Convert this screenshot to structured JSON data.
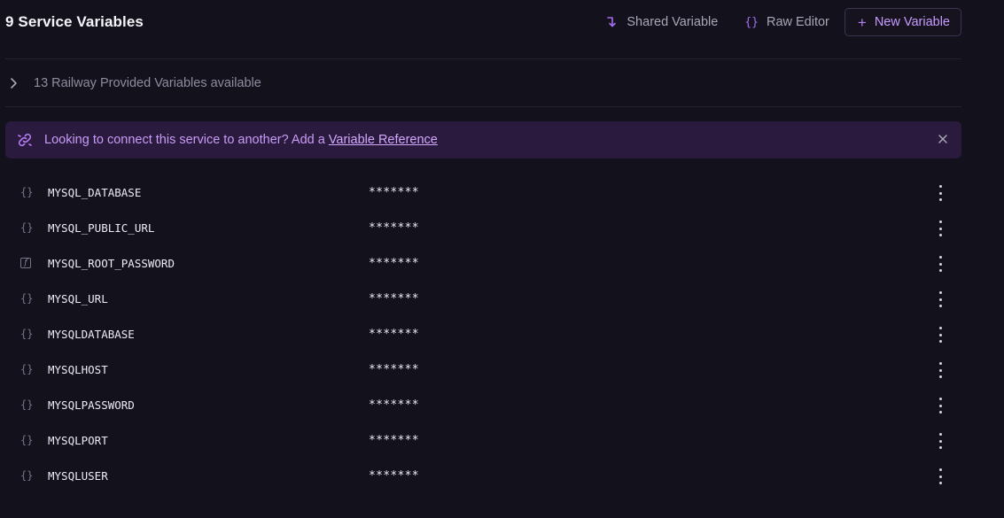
{
  "header": {
    "title": "9 Service Variables",
    "shared_label": "Shared Variable",
    "raw_label": "Raw Editor",
    "raw_icon_text": "{}",
    "new_label": "New Variable",
    "new_icon_text": "+"
  },
  "provided": {
    "label": "13 Railway Provided Variables available"
  },
  "banner": {
    "text": "Looking to connect this service to another? Add a",
    "link_label": "Variable Reference"
  },
  "variables": [
    {
      "icon": "braces-icon",
      "type_glyph": "{}",
      "name": "MYSQL_DATABASE",
      "value": "*******"
    },
    {
      "icon": "braces-icon",
      "type_glyph": "{}",
      "name": "MYSQL_PUBLIC_URL",
      "value": "*******"
    },
    {
      "icon": "function-icon",
      "type_glyph": "f",
      "name": "MYSQL_ROOT_PASSWORD",
      "value": "*******"
    },
    {
      "icon": "braces-icon",
      "type_glyph": "{}",
      "name": "MYSQL_URL",
      "value": "*******"
    },
    {
      "icon": "braces-icon",
      "type_glyph": "{}",
      "name": "MYSQLDATABASE",
      "value": "*******"
    },
    {
      "icon": "braces-icon",
      "type_glyph": "{}",
      "name": "MYSQLHOST",
      "value": "*******"
    },
    {
      "icon": "braces-icon",
      "type_glyph": "{}",
      "name": "MYSQLPASSWORD",
      "value": "*******"
    },
    {
      "icon": "braces-icon",
      "type_glyph": "{}",
      "name": "MYSQLPORT",
      "value": "*******"
    },
    {
      "icon": "braces-icon",
      "type_glyph": "{}",
      "name": "MYSQLUSER",
      "value": "*******"
    }
  ],
  "colors": {
    "background": "#13111c",
    "accent": "#a46ef0",
    "banner_bg": "#2a1a3d",
    "banner_text": "#c89cf7"
  }
}
